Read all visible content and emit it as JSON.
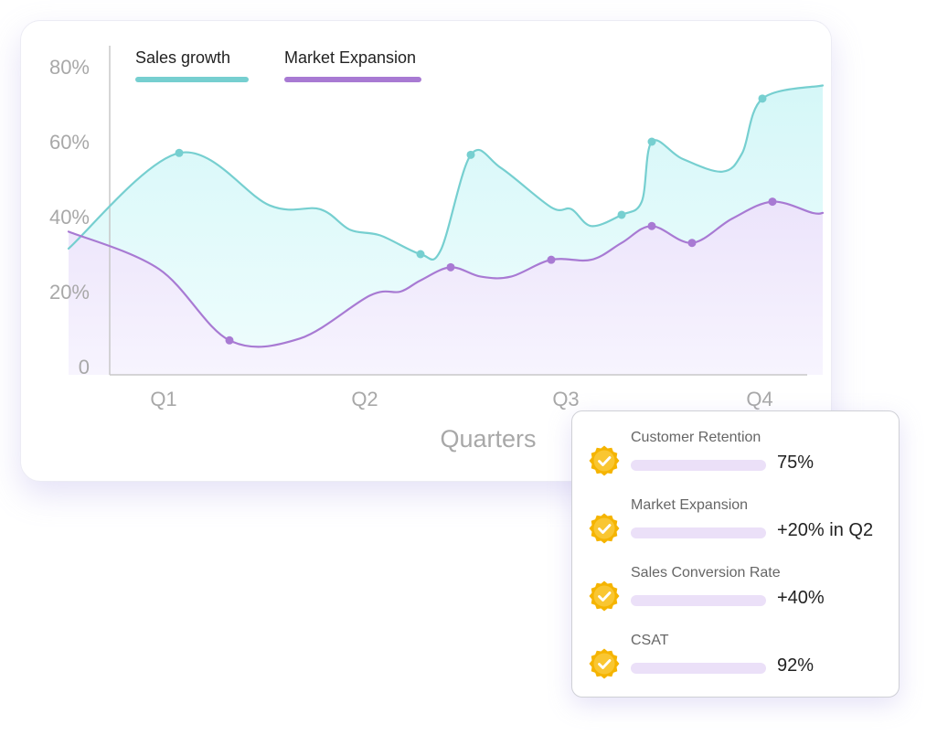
{
  "chart_data": {
    "type": "area",
    "xlabel": "Quarters",
    "x_ticks": [
      "Q1",
      "Q2",
      "Q3",
      "Q4"
    ],
    "y_ticks": [
      "0",
      "20%",
      "40%",
      "60%",
      "80%"
    ],
    "ylim": [
      0,
      80
    ],
    "xlim": [
      0.6,
      4.35
    ],
    "grid": false,
    "legend_position": "top-left",
    "series": [
      {
        "name": "Sales growth",
        "color": "#76cfd0",
        "curve": [
          [
            0.6,
            31.5
          ],
          [
            1.15,
            57
          ],
          [
            1.6,
            43
          ],
          [
            1.85,
            42
          ],
          [
            2.0,
            36.5
          ],
          [
            2.15,
            35
          ],
          [
            2.35,
            30
          ],
          [
            2.45,
            31
          ],
          [
            2.6,
            56.5
          ],
          [
            2.75,
            53
          ],
          [
            3.0,
            42.5
          ],
          [
            3.1,
            42
          ],
          [
            3.2,
            37.5
          ],
          [
            3.35,
            40.5
          ],
          [
            3.45,
            44
          ],
          [
            3.5,
            60
          ],
          [
            3.65,
            55.5
          ],
          [
            3.85,
            52
          ],
          [
            3.95,
            57
          ],
          [
            4.05,
            71.5
          ],
          [
            4.35,
            75
          ]
        ],
        "markers": [
          [
            1.15,
            57
          ],
          [
            2.35,
            30
          ],
          [
            2.6,
            56.5
          ],
          [
            3.35,
            40.5
          ],
          [
            3.5,
            60
          ],
          [
            4.05,
            71.5
          ]
        ]
      },
      {
        "name": "Market Expansion",
        "color": "#a87ad3",
        "curve": [
          [
            0.6,
            36
          ],
          [
            1.05,
            26
          ],
          [
            1.4,
            7
          ],
          [
            1.75,
            7.5
          ],
          [
            2.1,
            19
          ],
          [
            2.25,
            20
          ],
          [
            2.35,
            23
          ],
          [
            2.5,
            26.5
          ],
          [
            2.65,
            24
          ],
          [
            2.8,
            24
          ],
          [
            3.0,
            28.5
          ],
          [
            3.2,
            28.5
          ],
          [
            3.35,
            33
          ],
          [
            3.5,
            37.5
          ],
          [
            3.7,
            33
          ],
          [
            3.9,
            39.5
          ],
          [
            4.1,
            44
          ],
          [
            4.3,
            41
          ],
          [
            4.35,
            41
          ]
        ],
        "markers": [
          [
            1.4,
            7
          ],
          [
            2.5,
            26.5
          ],
          [
            3.0,
            28.5
          ],
          [
            3.5,
            37.5
          ],
          [
            3.7,
            33
          ],
          [
            4.1,
            44
          ]
        ]
      }
    ]
  },
  "metrics": [
    {
      "label": "Customer Retention",
      "value": "75%"
    },
    {
      "label": "Market Expansion",
      "value": "+20% in Q2"
    },
    {
      "label": "Sales Conversion Rate",
      "value": "+40%"
    },
    {
      "label": "CSAT",
      "value": "92%"
    }
  ],
  "colors": {
    "badge": "#f5b400",
    "badge_inner": "#f9c631",
    "bar": "#ebe0f8",
    "axis_text": "#a8a8a8"
  }
}
